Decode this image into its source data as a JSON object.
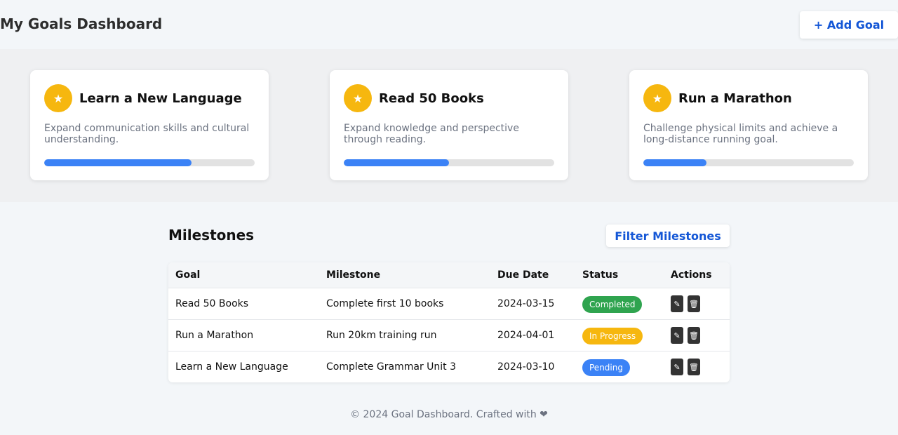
{
  "header": {
    "title": "My Goals Dashboard",
    "add_goal_label": "+ Add Goal"
  },
  "goals": [
    {
      "icon": "goal-icon",
      "title": "Learn a New Language",
      "description": "Expand communication skills and cultural understanding.",
      "progress_percent": 70
    },
    {
      "icon": "goal-icon",
      "title": "Read 50 Books",
      "description": "Expand knowledge and perspective through reading.",
      "progress_percent": 50
    },
    {
      "icon": "goal-icon",
      "title": "Run a Marathon",
      "description": "Challenge physical limits and achieve a long-distance running goal.",
      "progress_percent": 30
    }
  ],
  "milestones": {
    "title": "Milestones",
    "filter_label": "Filter Milestones",
    "columns": [
      "Goal",
      "Milestone",
      "Due Date",
      "Status",
      "Actions"
    ],
    "rows": [
      {
        "goal": "Read 50 Books",
        "milestone": "Complete first 10 books",
        "due_date": "2024-03-15",
        "status": "Completed",
        "status_color": "#2fa44f",
        "edit_icon": "✎",
        "delete_icon": "🗑"
      },
      {
        "goal": "Run a Marathon",
        "milestone": "Run 20km training run",
        "due_date": "2024-04-01",
        "status": "In Progress",
        "status_color": "#f6b70f",
        "edit_icon": "✎",
        "delete_icon": "🗑"
      },
      {
        "goal": "Learn a New Language",
        "milestone": "Complete Grammar Unit 3",
        "due_date": "2024-03-10",
        "status": "Pending",
        "status_color": "#3b82f6",
        "edit_icon": "✎",
        "delete_icon": "🗑"
      }
    ]
  },
  "footer": {
    "text": "© 2024 Goal Dashboard. Crafted with ❤"
  },
  "colors": {
    "accent": "#1356d6",
    "progress": "#3b82f6",
    "icon_bg": "#f6b70f"
  }
}
